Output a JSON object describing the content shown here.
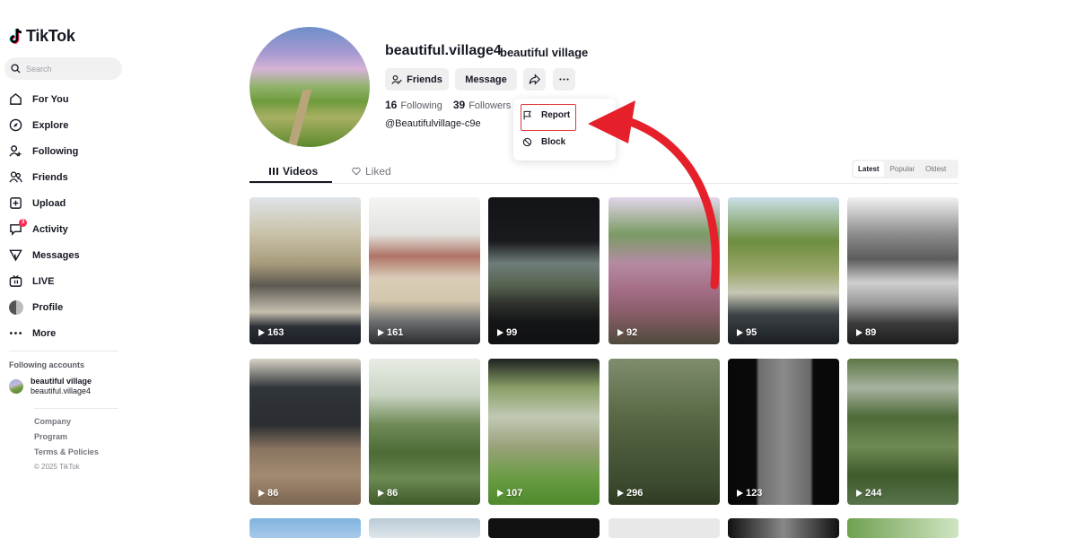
{
  "sidebar": {
    "logo": "TikTok",
    "search_placeholder": "Search",
    "nav": [
      {
        "label": "For You",
        "icon": "home-icon"
      },
      {
        "label": "Explore",
        "icon": "compass-icon"
      },
      {
        "label": "Following",
        "icon": "user-plus-icon"
      },
      {
        "label": "Friends",
        "icon": "friends-icon"
      },
      {
        "label": "Upload",
        "icon": "upload-icon"
      },
      {
        "label": "Activity",
        "icon": "activity-icon",
        "badge": "3"
      },
      {
        "label": "Messages",
        "icon": "messages-icon"
      },
      {
        "label": "LIVE",
        "icon": "live-icon"
      },
      {
        "label": "Profile",
        "icon": "profile-avatar-icon"
      },
      {
        "label": "More",
        "icon": "more-icon"
      }
    ],
    "following_accounts_title": "Following accounts",
    "following_accounts": [
      {
        "name": "beautiful village",
        "handle": "beautiful.village4"
      }
    ],
    "footer": {
      "company": "Company",
      "program": "Program",
      "terms": "Terms & Policies",
      "copyright": "© 2025 TikTok"
    }
  },
  "profile": {
    "username": "beautiful.village4",
    "nickname": "beautiful village",
    "buttons": {
      "friends": "Friends",
      "message": "Message"
    },
    "following_count": "16",
    "following_label": "Following",
    "followers_count": "39",
    "followers_label": "Followers",
    "handle": "@Beautifulvillage-c9e"
  },
  "menu": {
    "report": "Report",
    "block": "Block"
  },
  "tabs": {
    "videos": "Videos",
    "liked": "Liked"
  },
  "sort": {
    "latest": "Latest",
    "popular": "Popular",
    "oldest": "Oldest"
  },
  "videos": [
    "163",
    "161",
    "99",
    "92",
    "95",
    "89",
    "86",
    "86",
    "107",
    "296",
    "123",
    "244"
  ],
  "colors": {
    "accent": "#fe2c55",
    "highlight": "#e03a3a",
    "arrow": "#e5202a"
  }
}
